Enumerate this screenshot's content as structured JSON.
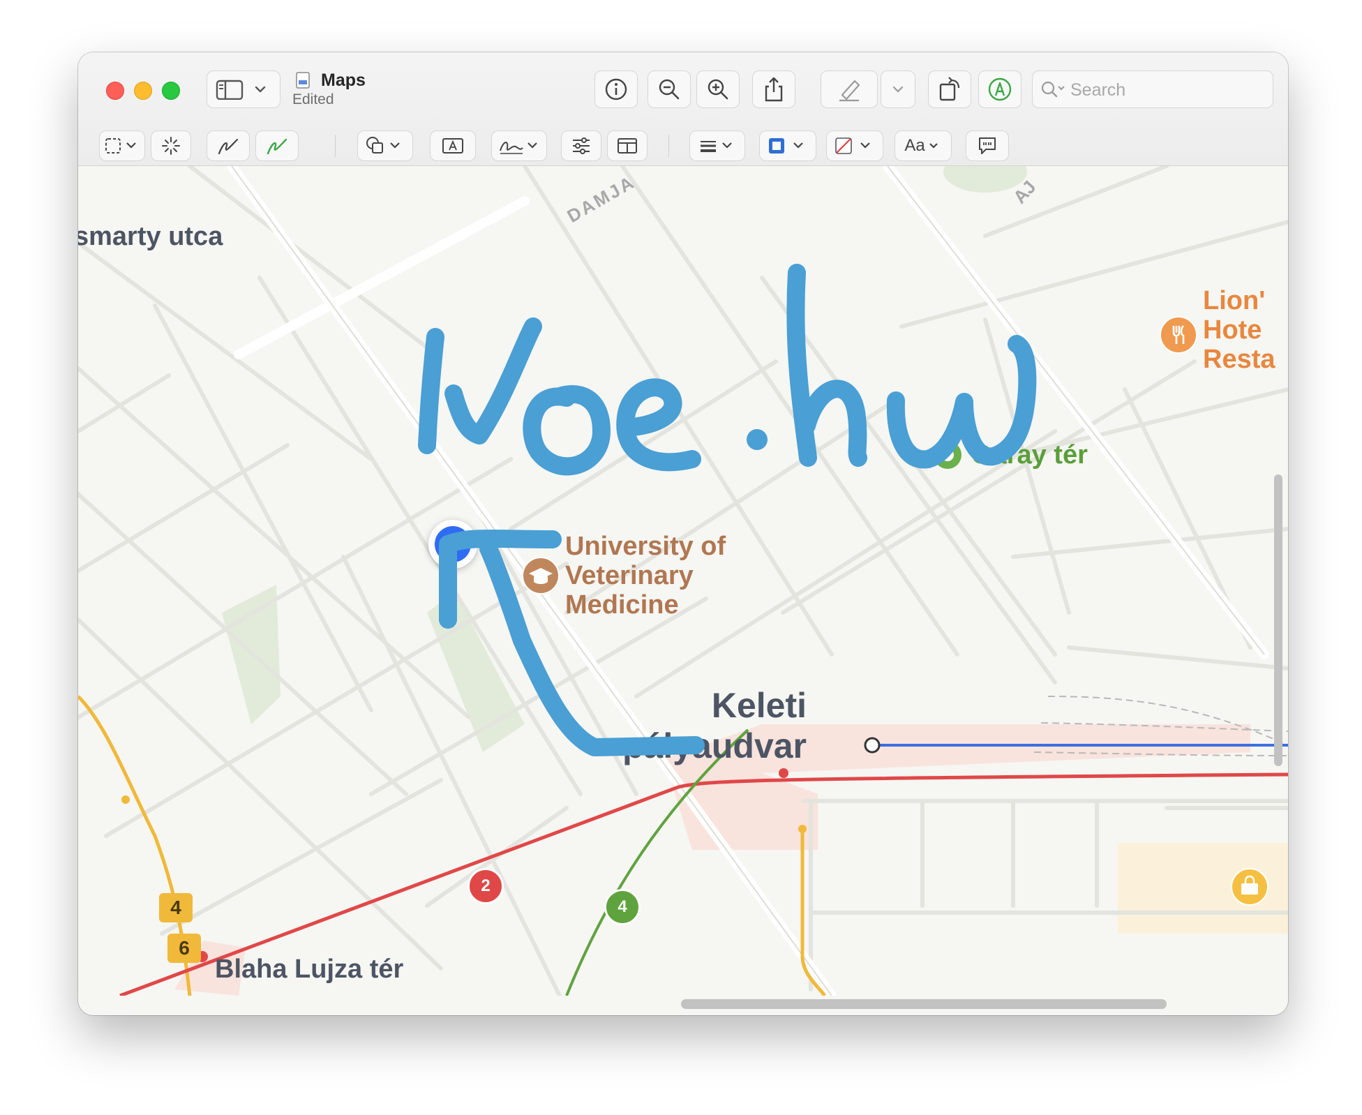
{
  "window": {
    "title": "Maps",
    "subtitle": "Edited"
  },
  "toolbar": {
    "search_placeholder": "Search",
    "text_style_label": "Aa"
  },
  "map": {
    "streets": {
      "street_1": "smarty utca",
      "street_2": "DAMJA",
      "street_3": "AJ"
    },
    "poi": {
      "hotel": [
        "Lion'",
        "Hote",
        "Resta"
      ],
      "university": [
        "University of",
        "Veterinary",
        "Medicine"
      ],
      "square": "Garay tér",
      "station": [
        "Keleti",
        "pályaudvar"
      ],
      "stop_bottom": "Blaha Lujza tér"
    },
    "transit_badges": {
      "metro_red": "2",
      "metro_green": "4",
      "tram_top": "4",
      "tram_bottom": "6"
    },
    "colors": {
      "annotation_blue": "#4a9fd4",
      "location_dot": "#2f6cf5",
      "poi_orange": "#e8873e",
      "poi_brown": "#b07751",
      "poi_green": "#6ab04c",
      "metro_red": "#e04848",
      "metro_green": "#5fa33e",
      "tram_yellow": "#f0b93a"
    }
  },
  "annotation": {
    "handwritten_text": "ivoe.hu"
  }
}
